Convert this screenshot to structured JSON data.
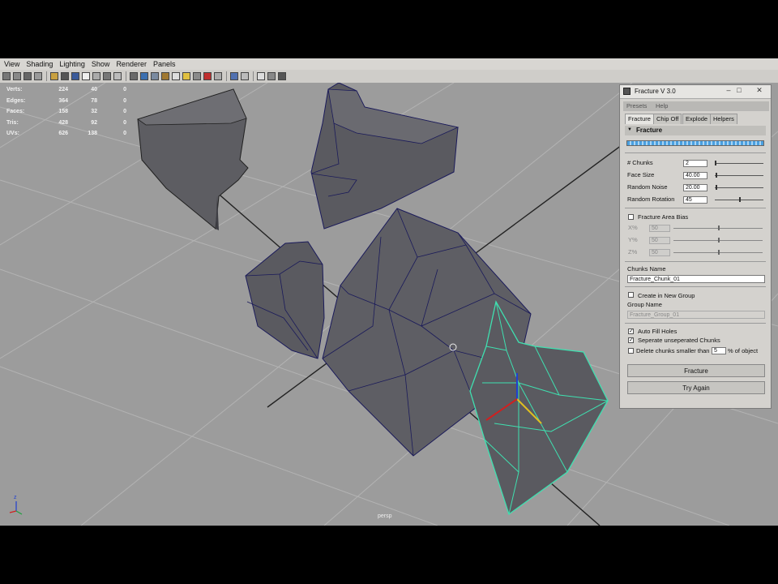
{
  "menubar": [
    "View",
    "Shading",
    "Lighting",
    "Show",
    "Renderer",
    "Panels"
  ],
  "hud": [
    {
      "label": "Verts:",
      "a": "224",
      "b": "40",
      "c": "0"
    },
    {
      "label": "Edges:",
      "a": "364",
      "b": "78",
      "c": "0"
    },
    {
      "label": "Faces:",
      "a": "158",
      "b": "32",
      "c": "0"
    },
    {
      "label": "Tris:",
      "a": "428",
      "b": "92",
      "c": "0"
    },
    {
      "label": "UVs:",
      "a": "626",
      "b": "138",
      "c": "0"
    }
  ],
  "viewport": {
    "camera": "persp",
    "axis_z": "z"
  },
  "dialog": {
    "title": "Fracture V 3.0",
    "menu": [
      "Presets",
      "Help"
    ],
    "tabs": [
      "Fracture",
      "Chip Off",
      "Explode",
      "Helpers"
    ],
    "section": "Fracture",
    "params": [
      {
        "label": "# Chunks",
        "value": "2",
        "level": 0.0
      },
      {
        "label": "Face Size",
        "value": "40.00",
        "level": 0.02
      },
      {
        "label": "Random Noise",
        "value": "20.00",
        "level": 0.02
      },
      {
        "label": "Random Rotation",
        "value": "45",
        "level": 0.5
      }
    ],
    "bias": {
      "label": "Fracture Area Bias",
      "checked": false,
      "axes": [
        {
          "label": "X%",
          "value": "50",
          "level": 0.5
        },
        {
          "label": "Y%",
          "value": "50",
          "level": 0.5
        },
        {
          "label": "Z%",
          "value": "50",
          "level": 0.5
        }
      ]
    },
    "chunks_name_label": "Chunks Name",
    "chunks_name_value": "Fracture_Chunk_01",
    "create_group_label": "Create in New Group",
    "group_name_label": "Group Name",
    "group_name_value": "Fracture_Group_01",
    "auto_fill_label": "Auto Fill Holes",
    "separate_label": "Seperate unseperated Chunks",
    "delete_label": "Delete chunks smaller than",
    "delete_value": "5",
    "delete_suffix": "% of object",
    "fracture_button": "Fracture",
    "try_again_button": "Try Again",
    "win_controls": [
      "–",
      "□",
      "✕"
    ]
  },
  "colors": {
    "viewport_bg": "#9c9c9c",
    "selection": "#3fe0b0",
    "mesh": "#5b5b60",
    "wire": "#1a1a66"
  }
}
